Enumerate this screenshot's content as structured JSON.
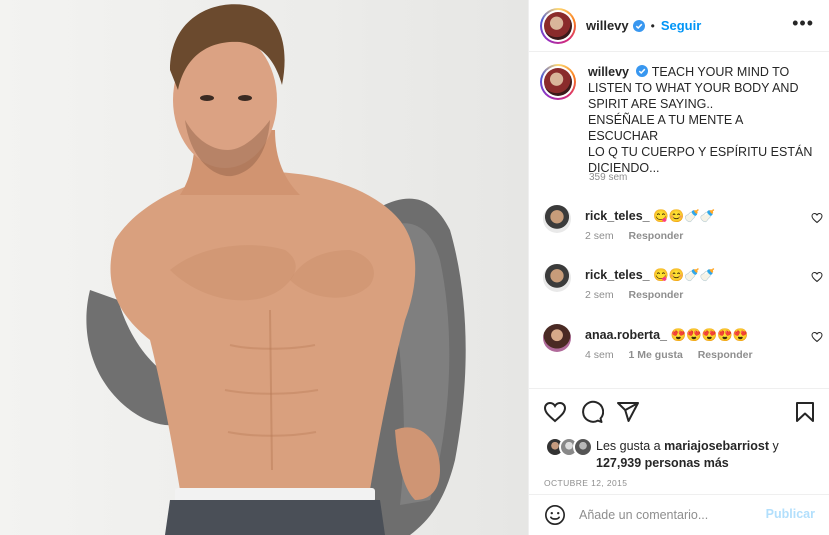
{
  "post": {
    "username": "willevy",
    "follow_label": "Seguir",
    "separator": "•",
    "more_label": "•••"
  },
  "caption": {
    "username": "willevy",
    "text": "TEACH YOUR MIND TO LISTEN TO WHAT YOUR BODY AND SPIRIT ARE SAYING..",
    "text_es_1": "ENSÉÑALE A TU MENTE A ESCUCHAR",
    "text_es_2": "LO Q TU CUERPO Y ESPÍRITU ESTÁN",
    "text_es_3": "DICIENDO...",
    "time": "359 sem"
  },
  "comments": [
    {
      "username": "rick_teles_",
      "text": "😋😊🍼🍼",
      "time": "2 sem",
      "reply": "Responder"
    },
    {
      "username": "rick_teles_",
      "text": "😋😊🍼🍼",
      "time": "2 sem",
      "reply": "Responder"
    },
    {
      "username": "anaa.roberta_",
      "text": "😍😍😍😍😍",
      "time": "4 sem",
      "likes": "1 Me gusta",
      "reply": "Responder"
    }
  ],
  "likes": {
    "prefix": "Les gusta a",
    "user": "mariajosebarriost",
    "conjunction": "y",
    "count": "127,939 personas más"
  },
  "date": "OCTUBRE 12, 2015",
  "composer": {
    "placeholder": "Añade un comentario...",
    "publish_label": "Publicar"
  },
  "colors": {
    "accent": "#0095f6",
    "accent_disabled": "#b2dffc",
    "verified": "#3897f0",
    "muted": "#8e8e8e"
  },
  "icons": [
    "verified-icon",
    "more-icon",
    "heart-icon",
    "comment-icon",
    "share-icon",
    "bookmark-icon",
    "emoji-icon"
  ]
}
